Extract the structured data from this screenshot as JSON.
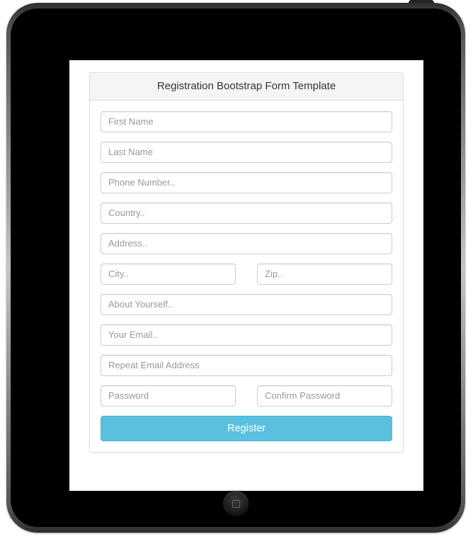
{
  "form": {
    "title": "Registration Bootstrap Form Template",
    "fields": {
      "first_name": {
        "placeholder": "First Name",
        "value": ""
      },
      "last_name": {
        "placeholder": "Last Name",
        "value": ""
      },
      "phone": {
        "placeholder": "Phone Number..",
        "value": ""
      },
      "country": {
        "placeholder": "Country..",
        "value": ""
      },
      "address": {
        "placeholder": "Address..",
        "value": ""
      },
      "city": {
        "placeholder": "City..",
        "value": ""
      },
      "zip": {
        "placeholder": "Zip..",
        "value": ""
      },
      "about": {
        "placeholder": "About Yourself..",
        "value": ""
      },
      "email": {
        "placeholder": "Your Email..",
        "value": ""
      },
      "email2": {
        "placeholder": "Repeat Email Address",
        "value": ""
      },
      "password": {
        "placeholder": "Password",
        "value": ""
      },
      "password2": {
        "placeholder": "Confirm Password",
        "value": ""
      }
    },
    "submit_label": "Register"
  },
  "colors": {
    "accent": "#5bc0de"
  }
}
